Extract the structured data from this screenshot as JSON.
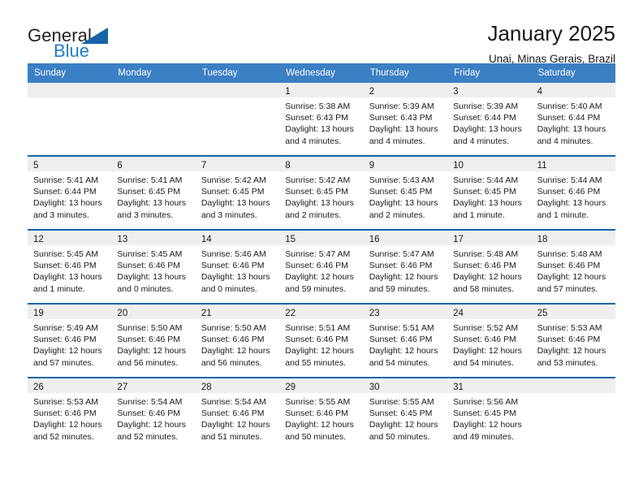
{
  "brand": {
    "line1": "General",
    "line2": "Blue",
    "triangle_color": "#1565a8"
  },
  "header": {
    "title": "January 2025",
    "subtitle": "Unai, Minas Gerais, Brazil"
  },
  "theme": {
    "header_blue": "#3b7fc4",
    "rule_blue": "#1565a8",
    "day_band_gray": "#efefef"
  },
  "weekdays": [
    "Sunday",
    "Monday",
    "Tuesday",
    "Wednesday",
    "Thursday",
    "Friday",
    "Saturday"
  ],
  "weeks": [
    [
      {
        "day": "",
        "empty": true
      },
      {
        "day": "",
        "empty": true
      },
      {
        "day": "",
        "empty": true
      },
      {
        "day": "1",
        "sunrise": "Sunrise: 5:38 AM",
        "sunset": "Sunset: 6:43 PM",
        "daylight1": "Daylight: 13 hours",
        "daylight2": "and 4 minutes."
      },
      {
        "day": "2",
        "sunrise": "Sunrise: 5:39 AM",
        "sunset": "Sunset: 6:43 PM",
        "daylight1": "Daylight: 13 hours",
        "daylight2": "and 4 minutes."
      },
      {
        "day": "3",
        "sunrise": "Sunrise: 5:39 AM",
        "sunset": "Sunset: 6:44 PM",
        "daylight1": "Daylight: 13 hours",
        "daylight2": "and 4 minutes."
      },
      {
        "day": "4",
        "sunrise": "Sunrise: 5:40 AM",
        "sunset": "Sunset: 6:44 PM",
        "daylight1": "Daylight: 13 hours",
        "daylight2": "and 4 minutes."
      }
    ],
    [
      {
        "day": "5",
        "sunrise": "Sunrise: 5:41 AM",
        "sunset": "Sunset: 6:44 PM",
        "daylight1": "Daylight: 13 hours",
        "daylight2": "and 3 minutes."
      },
      {
        "day": "6",
        "sunrise": "Sunrise: 5:41 AM",
        "sunset": "Sunset: 6:45 PM",
        "daylight1": "Daylight: 13 hours",
        "daylight2": "and 3 minutes."
      },
      {
        "day": "7",
        "sunrise": "Sunrise: 5:42 AM",
        "sunset": "Sunset: 6:45 PM",
        "daylight1": "Daylight: 13 hours",
        "daylight2": "and 3 minutes."
      },
      {
        "day": "8",
        "sunrise": "Sunrise: 5:42 AM",
        "sunset": "Sunset: 6:45 PM",
        "daylight1": "Daylight: 13 hours",
        "daylight2": "and 2 minutes."
      },
      {
        "day": "9",
        "sunrise": "Sunrise: 5:43 AM",
        "sunset": "Sunset: 6:45 PM",
        "daylight1": "Daylight: 13 hours",
        "daylight2": "and 2 minutes."
      },
      {
        "day": "10",
        "sunrise": "Sunrise: 5:44 AM",
        "sunset": "Sunset: 6:45 PM",
        "daylight1": "Daylight: 13 hours",
        "daylight2": "and 1 minute."
      },
      {
        "day": "11",
        "sunrise": "Sunrise: 5:44 AM",
        "sunset": "Sunset: 6:46 PM",
        "daylight1": "Daylight: 13 hours",
        "daylight2": "and 1 minute."
      }
    ],
    [
      {
        "day": "12",
        "sunrise": "Sunrise: 5:45 AM",
        "sunset": "Sunset: 6:46 PM",
        "daylight1": "Daylight: 13 hours",
        "daylight2": "and 1 minute."
      },
      {
        "day": "13",
        "sunrise": "Sunrise: 5:45 AM",
        "sunset": "Sunset: 6:46 PM",
        "daylight1": "Daylight: 13 hours",
        "daylight2": "and 0 minutes."
      },
      {
        "day": "14",
        "sunrise": "Sunrise: 5:46 AM",
        "sunset": "Sunset: 6:46 PM",
        "daylight1": "Daylight: 13 hours",
        "daylight2": "and 0 minutes."
      },
      {
        "day": "15",
        "sunrise": "Sunrise: 5:47 AM",
        "sunset": "Sunset: 6:46 PM",
        "daylight1": "Daylight: 12 hours",
        "daylight2": "and 59 minutes."
      },
      {
        "day": "16",
        "sunrise": "Sunrise: 5:47 AM",
        "sunset": "Sunset: 6:46 PM",
        "daylight1": "Daylight: 12 hours",
        "daylight2": "and 59 minutes."
      },
      {
        "day": "17",
        "sunrise": "Sunrise: 5:48 AM",
        "sunset": "Sunset: 6:46 PM",
        "daylight1": "Daylight: 12 hours",
        "daylight2": "and 58 minutes."
      },
      {
        "day": "18",
        "sunrise": "Sunrise: 5:48 AM",
        "sunset": "Sunset: 6:46 PM",
        "daylight1": "Daylight: 12 hours",
        "daylight2": "and 57 minutes."
      }
    ],
    [
      {
        "day": "19",
        "sunrise": "Sunrise: 5:49 AM",
        "sunset": "Sunset: 6:46 PM",
        "daylight1": "Daylight: 12 hours",
        "daylight2": "and 57 minutes."
      },
      {
        "day": "20",
        "sunrise": "Sunrise: 5:50 AM",
        "sunset": "Sunset: 6:46 PM",
        "daylight1": "Daylight: 12 hours",
        "daylight2": "and 56 minutes."
      },
      {
        "day": "21",
        "sunrise": "Sunrise: 5:50 AM",
        "sunset": "Sunset: 6:46 PM",
        "daylight1": "Daylight: 12 hours",
        "daylight2": "and 56 minutes."
      },
      {
        "day": "22",
        "sunrise": "Sunrise: 5:51 AM",
        "sunset": "Sunset: 6:46 PM",
        "daylight1": "Daylight: 12 hours",
        "daylight2": "and 55 minutes."
      },
      {
        "day": "23",
        "sunrise": "Sunrise: 5:51 AM",
        "sunset": "Sunset: 6:46 PM",
        "daylight1": "Daylight: 12 hours",
        "daylight2": "and 54 minutes."
      },
      {
        "day": "24",
        "sunrise": "Sunrise: 5:52 AM",
        "sunset": "Sunset: 6:46 PM",
        "daylight1": "Daylight: 12 hours",
        "daylight2": "and 54 minutes."
      },
      {
        "day": "25",
        "sunrise": "Sunrise: 5:53 AM",
        "sunset": "Sunset: 6:46 PM",
        "daylight1": "Daylight: 12 hours",
        "daylight2": "and 53 minutes."
      }
    ],
    [
      {
        "day": "26",
        "sunrise": "Sunrise: 5:53 AM",
        "sunset": "Sunset: 6:46 PM",
        "daylight1": "Daylight: 12 hours",
        "daylight2": "and 52 minutes."
      },
      {
        "day": "27",
        "sunrise": "Sunrise: 5:54 AM",
        "sunset": "Sunset: 6:46 PM",
        "daylight1": "Daylight: 12 hours",
        "daylight2": "and 52 minutes."
      },
      {
        "day": "28",
        "sunrise": "Sunrise: 5:54 AM",
        "sunset": "Sunset: 6:46 PM",
        "daylight1": "Daylight: 12 hours",
        "daylight2": "and 51 minutes."
      },
      {
        "day": "29",
        "sunrise": "Sunrise: 5:55 AM",
        "sunset": "Sunset: 6:46 PM",
        "daylight1": "Daylight: 12 hours",
        "daylight2": "and 50 minutes."
      },
      {
        "day": "30",
        "sunrise": "Sunrise: 5:55 AM",
        "sunset": "Sunset: 6:45 PM",
        "daylight1": "Daylight: 12 hours",
        "daylight2": "and 50 minutes."
      },
      {
        "day": "31",
        "sunrise": "Sunrise: 5:56 AM",
        "sunset": "Sunset: 6:45 PM",
        "daylight1": "Daylight: 12 hours",
        "daylight2": "and 49 minutes."
      },
      {
        "day": "",
        "empty": true
      }
    ]
  ]
}
